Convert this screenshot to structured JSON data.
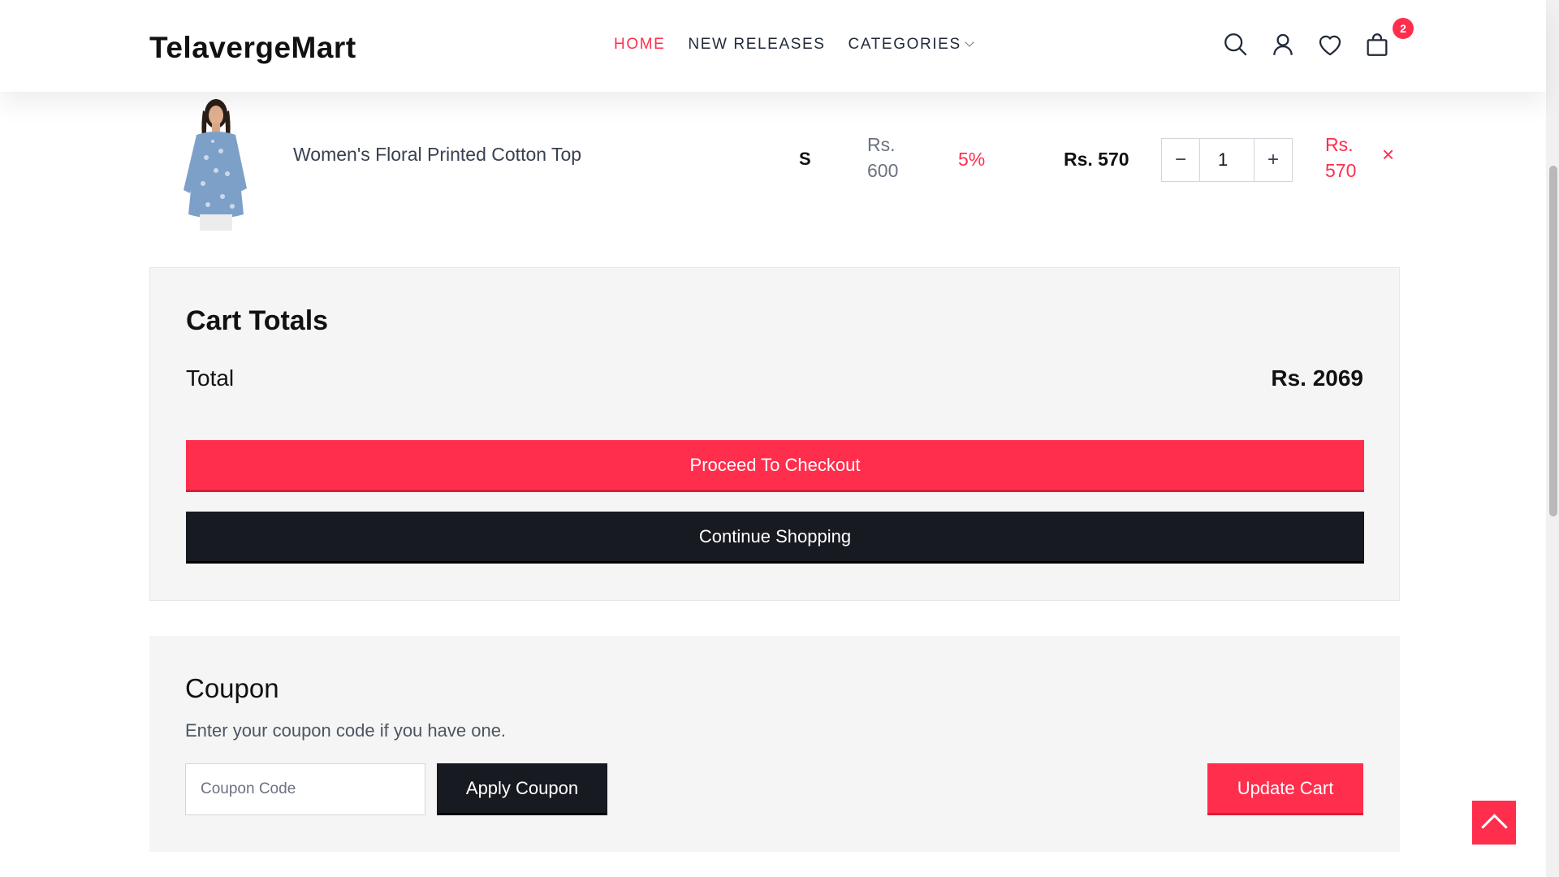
{
  "header": {
    "logo": "TelavergeMart",
    "nav": [
      {
        "label": "HOME",
        "active": true
      },
      {
        "label": "NEW RELEASES",
        "active": false
      },
      {
        "label": "CATEGORIES",
        "active": false
      }
    ],
    "icons": [
      "search-icon",
      "user-icon",
      "heart-icon",
      "shopping-bag-icon"
    ],
    "cart_count": "2"
  },
  "cart_item": {
    "image": "product-photo",
    "name": "Women's Floral Printed Cotton Top",
    "size": "S",
    "price": "Rs. 600",
    "discount": "5%",
    "final_price": "Rs. 570",
    "quantity": "1",
    "qty_minus": "−",
    "qty_plus": "+",
    "subtotal": "Rs. 570",
    "remove": "×"
  },
  "cart_totals": {
    "title": "Cart Totals",
    "total_label": "Total",
    "total_value": "Rs. 2069",
    "checkout_label": "Proceed To Checkout",
    "continue_label": "Continue Shopping"
  },
  "coupon": {
    "title": "Coupon",
    "description": "Enter your coupon code if you have one.",
    "input_placeholder": "Coupon Code",
    "apply_label": "Apply Coupon",
    "update_label": "Update Cart"
  },
  "colors": {
    "accent": "#ff2e4d",
    "dark": "#181a21",
    "panel": "#f5f5f5"
  }
}
